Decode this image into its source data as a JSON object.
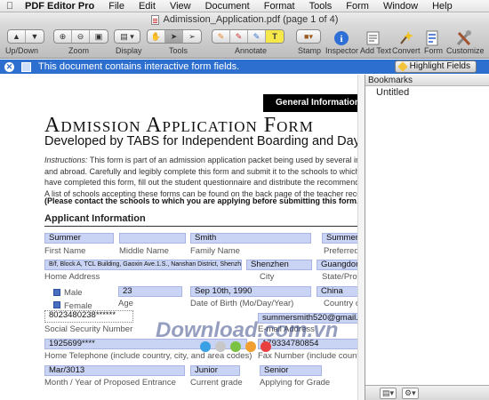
{
  "menubar": {
    "app": "PDF Editor Pro",
    "items": [
      "File",
      "Edit",
      "View",
      "Document",
      "Format",
      "Tools",
      "Form",
      "Window",
      "Help"
    ]
  },
  "window": {
    "title": "Adimission_Application.pdf (page 1 of 4)"
  },
  "toolbar": {
    "labels": {
      "updown": "Up/Down",
      "zoom": "Zoom",
      "display": "Display",
      "tools": "Tools",
      "annotate": "Annotate",
      "stamp": "Stamp",
      "inspector": "Inspector",
      "addtext": "Add Text",
      "convert": "Convert",
      "form": "Form",
      "customize": "Customize"
    }
  },
  "notification": {
    "message": "This document contains interactive form fields.",
    "button": "Highlight Fields"
  },
  "sidebar": {
    "header": "Bookmarks",
    "items": [
      "Untitled"
    ]
  },
  "document": {
    "banner": "General Information",
    "title": "Admission Application Form",
    "subtitle": "Developed by TABS for Independent Boarding and Day Sc",
    "instructions_label": "Instructions:",
    "instructions_lines": [
      " This form is part of an admission application packet being used by several independent sch",
      "and abroad.   Carefully and legibly complete this form and submit it to the schools to which  you want",
      "have completed this form, fill out the student questionnaire and distribute the recommendation forms",
      "A list of schools accepting these  forms can be found on the back page of the teacher recommenda tio"
    ],
    "contact_note": "(Please contact the schools to which you are applying before submitting this form.)",
    "section_title": "Applicant Information",
    "fields": {
      "first_name": "Summer",
      "family_name": "Smith",
      "preferred_name": "Summer",
      "home_address": "B/f, Block A, TCL Building, Gaoxin Ave.1.S., Nanshan District, Shenzhen",
      "city": "Shenzhen",
      "state": "Guangdong",
      "age": "23",
      "dob": "Sep 10th, 1990",
      "country": "China",
      "ssn": "8023480238******",
      "email": "summersmith520@gmail.com",
      "home_phone": "1925699****",
      "fax": "179334780854",
      "entrance": "Mar/3013",
      "grade": "Junior",
      "applying_grade": "Senior"
    },
    "labels": {
      "first_name": "First Name",
      "middle_name": "Middle Name",
      "family_name": "Family Name",
      "preferred_name": "Preferred Na",
      "home_address": "Home Address",
      "city": "City",
      "state": "State/Provinc",
      "male": "Male",
      "female": "Female",
      "age": "Age",
      "dob": "Date of Birth (Mo/Day/Year)",
      "country": "Country of B",
      "ssn": "Social Security Number",
      "email": "E-mail Address",
      "home_phone": "Home Telephone (include country, city, and area codes)",
      "fax": "Fax Number (include country, c",
      "entrance": "Month  /  Year of Proposed Entrance",
      "grade": "Current grade",
      "applying": "Applying for Grade"
    },
    "watermark": "Download.com.vn"
  },
  "colors": {
    "notify_bar": "#2d6fcf",
    "field_fill": "#c9d3f3"
  }
}
